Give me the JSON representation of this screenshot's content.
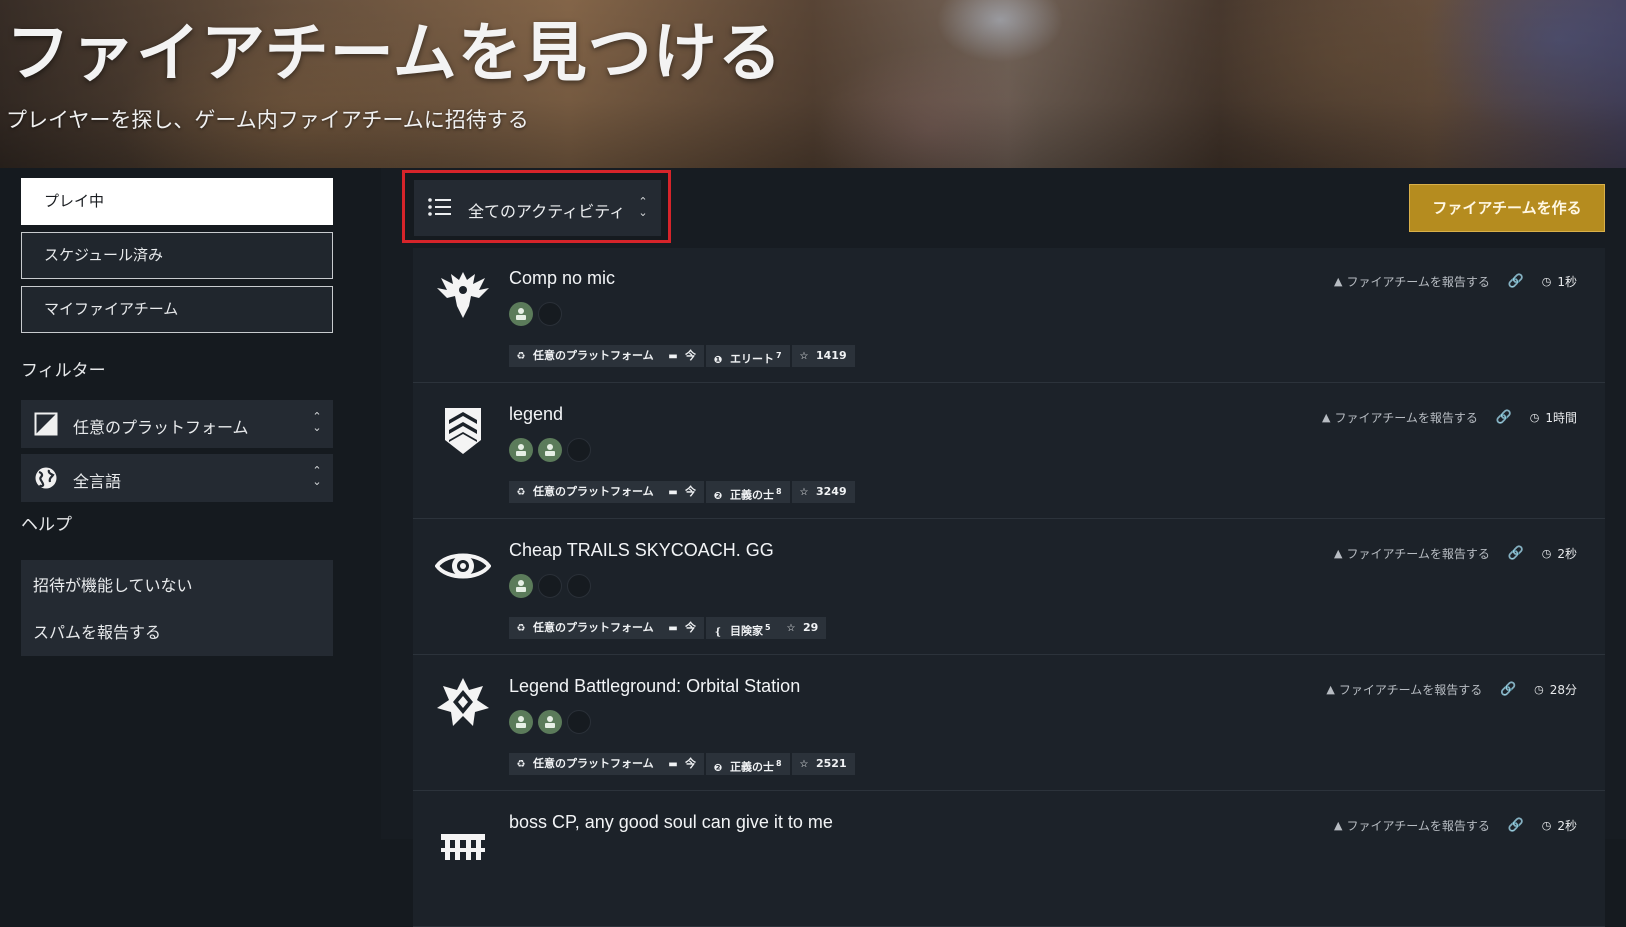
{
  "hero": {
    "title": "ファイアチームを見つける",
    "subtitle": "プレイヤーを探し、ゲーム内ファイアチームに招待する"
  },
  "sidebar": {
    "tabs": [
      {
        "label": "プレイ中",
        "active": true
      },
      {
        "label": "スケジュール済み",
        "active": false
      },
      {
        "label": "マイファイアチーム",
        "active": false
      }
    ],
    "filter_label": "フィルター",
    "filters": [
      {
        "label": "任意のプラットフォーム",
        "icon": "platform-icon"
      },
      {
        "label": "全言語",
        "icon": "globe-icon"
      }
    ],
    "help_label": "ヘルプ",
    "help_items": [
      "招待が機能していない",
      "スパムを報告する"
    ]
  },
  "toolbar": {
    "activity_select": "全てのアクティビティ",
    "create_button": "ファイアチームを作る"
  },
  "colors": {
    "accent": "#b58c1f",
    "highlight_border": "#d6242a",
    "slot_filled": "#5b7b5a"
  },
  "fireteams": [
    {
      "title": "Comp no mic",
      "emblem": "winged-crest-emblem",
      "slots": [
        true,
        false
      ],
      "tags": {
        "platform": "任意のプラットフォーム",
        "when": "今",
        "rank": "エリート",
        "rank_num": "7",
        "power": "1419"
      },
      "report": "ファイアチームを報告する",
      "time": "1秒"
    },
    {
      "title": "legend",
      "emblem": "chevron-shield-emblem",
      "slots": [
        true,
        true,
        false
      ],
      "tags": {
        "platform": "任意のプラットフォーム",
        "when": "今",
        "rank": "正義の士",
        "rank_num": "8",
        "power": "3249"
      },
      "report": "ファイアチームを報告する",
      "time": "1時間"
    },
    {
      "title": "Cheap TRAILS SKYCOACH. GG",
      "emblem": "eye-emblem",
      "slots": [
        true,
        false,
        false
      ],
      "tags": {
        "platform": "任意のプラットフォーム",
        "when": "今",
        "rank": "目険家",
        "rank_num": "5",
        "power": "29"
      },
      "report": "ファイアチームを報告する",
      "time": "2秒"
    },
    {
      "title": "Legend Battleground: Orbital Station",
      "emblem": "star-knot-emblem",
      "slots": [
        true,
        true,
        false
      ],
      "tags": {
        "platform": "任意のプラットフォーム",
        "when": "今",
        "rank": "正義の士",
        "rank_num": "8",
        "power": "2521"
      },
      "report": "ファイアチームを報告する",
      "time": "28分"
    },
    {
      "title": "boss CP, any good soul can give it to me",
      "emblem": "grid-emblem",
      "slots": [],
      "tags": {},
      "report": "ファイアチームを報告する",
      "time": "2秒"
    }
  ]
}
